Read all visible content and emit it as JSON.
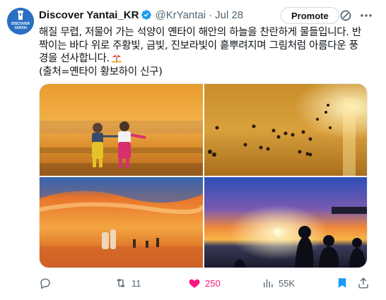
{
  "author": {
    "display_name": "Discover Yantai_KR",
    "handle": "@KrYantai",
    "separator": "·",
    "time": "Jul 28",
    "avatar_text_1": "DISCOVER",
    "avatar_text_2": "YANTAI"
  },
  "header": {
    "promote_label": "Promote"
  },
  "tweet": {
    "lines": [
      "해질 무렵, 저물어 가는 석양이 옌타이 해안의 하늘을 찬란하게 물들입니다. 반",
      "짝이는 바다 위로 주황빛, 금빛, 진보라빛이 흩뿌려지며 그림처럼 아름다운 풍",
      "경을 선사합니다.",
      "(출처=옌타이 황보하이 신구)"
    ],
    "emoji": "beach-umbrella-icon"
  },
  "media": {
    "photos": [
      "children-on-beach-photo",
      "swimmers-golden-sea-photo",
      "orange-sky-shore-photo",
      "sunset-silhouettes-photo"
    ]
  },
  "actions": {
    "reply_count": "",
    "retweet_count": "11",
    "like_count": "250",
    "views_count": "55K"
  },
  "colors": {
    "like_pink": "#f91880",
    "verified_blue": "#1d9bf0",
    "bookmark_blue": "#1d9bf0",
    "secondary_text": "#536471"
  }
}
